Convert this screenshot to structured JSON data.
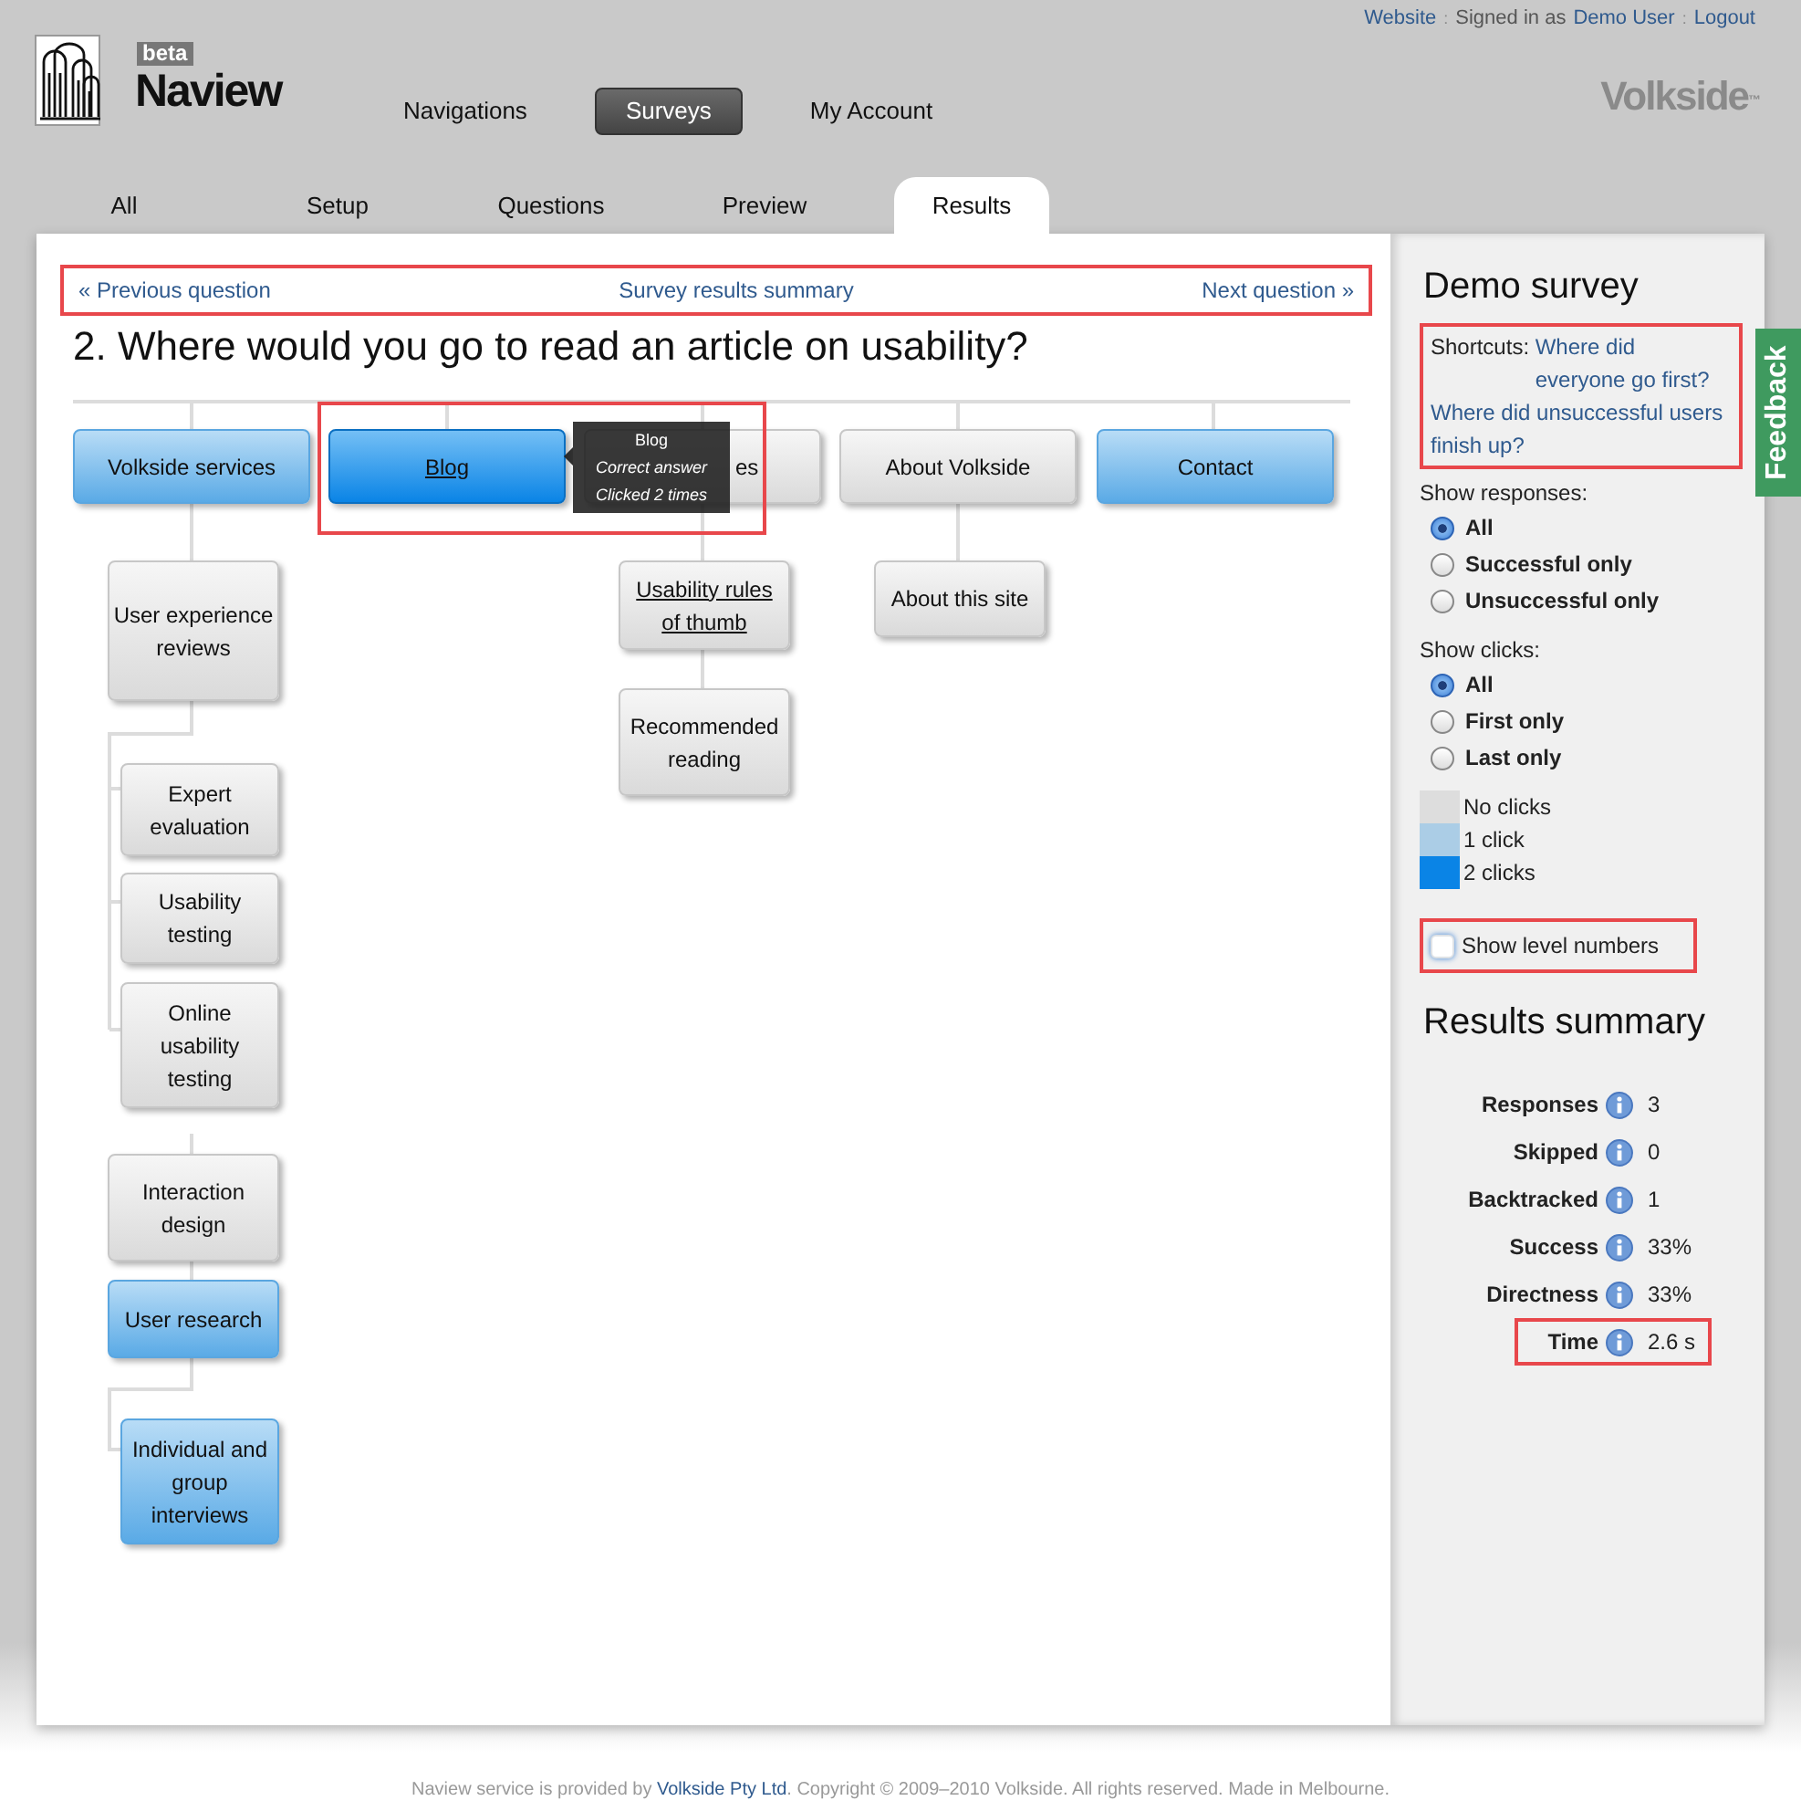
{
  "header": {
    "top_links": [
      {
        "text": "Website",
        "kind": "link"
      },
      {
        "text": ":",
        "kind": "sep"
      },
      {
        "text": "Signed in as",
        "kind": "text"
      },
      {
        "text": "Demo User",
        "kind": "link"
      },
      {
        "text": ":",
        "kind": "sep"
      },
      {
        "text": "Logout",
        "kind": "link"
      }
    ],
    "logo": {
      "badge": "beta",
      "name": "Naview"
    },
    "brand": {
      "name": "Volkside",
      "mark": "™"
    },
    "nav": [
      {
        "label": "Navigations",
        "selected": false
      },
      {
        "label": "Surveys",
        "selected": true
      },
      {
        "label": "My Account",
        "selected": false
      }
    ]
  },
  "tabs": [
    {
      "label": "All",
      "selected": false
    },
    {
      "label": "Setup",
      "selected": false
    },
    {
      "label": "Questions",
      "selected": false
    },
    {
      "label": "Preview",
      "selected": false
    },
    {
      "label": "Results",
      "selected": true
    }
  ],
  "question_nav": {
    "highlighted": true,
    "previous": "« Previous question",
    "summary": "Survey results summary",
    "next": "Next question »"
  },
  "question": "2. Where would you go to read an article on usability?",
  "tree": [
    {
      "label": "Volkside services",
      "kind": "light",
      "correct": false,
      "children": [
        {
          "label": "User experience reviews",
          "kind": "plain",
          "correct": false,
          "children": [
            {
              "label": "Expert evaluation",
              "kind": "plain",
              "correct": false
            },
            {
              "label": "Usability testing",
              "kind": "plain",
              "correct": false
            },
            {
              "label": "Online usability testing",
              "kind": "plain",
              "correct": false
            }
          ]
        },
        {
          "label": "Interaction design",
          "kind": "plain",
          "correct": false
        },
        {
          "label": "User research",
          "kind": "light",
          "correct": false,
          "children": [
            {
              "label": "Individual and group interviews",
              "kind": "light",
              "correct": false
            }
          ]
        }
      ]
    },
    {
      "label": "Blog",
      "kind": "dark",
      "correct": true
    },
    {
      "label": "es",
      "kind": "plain",
      "correct": false,
      "children": [
        {
          "label": "Usability rules of thumb",
          "kind": "plain",
          "correct": true
        },
        {
          "label": "Recommended reading",
          "kind": "plain",
          "correct": false
        }
      ]
    },
    {
      "label": "About Volkside",
      "kind": "plain",
      "correct": false,
      "children": [
        {
          "label": "About this site",
          "kind": "plain",
          "correct": false
        }
      ]
    },
    {
      "label": "Contact",
      "kind": "light",
      "correct": false
    }
  ],
  "tooltip": {
    "highlighted": true,
    "title": "Blog",
    "lines": [
      "Correct answer",
      "Clicked 2 times"
    ]
  },
  "sidebar": {
    "title": "Demo survey",
    "shortcuts": {
      "highlighted": true,
      "label": "Shortcuts:",
      "links": [
        "Where did everyone go first?",
        "Where did unsuccessful users finish up?"
      ]
    },
    "response_filter": {
      "label": "Show responses:",
      "options": [
        {
          "label": "All",
          "selected": true
        },
        {
          "label": "Successful only",
          "selected": false
        },
        {
          "label": "Unsuccessful only",
          "selected": false
        }
      ]
    },
    "click_filter": {
      "label": "Show clicks:",
      "options": [
        {
          "label": "All",
          "selected": true
        },
        {
          "label": "First only",
          "selected": false
        },
        {
          "label": "Last only",
          "selected": false
        }
      ]
    },
    "legend": [
      {
        "label": "No clicks",
        "color": "#dddddd"
      },
      {
        "label": "1 click",
        "color": "#abcde6"
      },
      {
        "label": "2 clicks",
        "color": "#0a84e6"
      }
    ],
    "level_numbers": {
      "label": "Show level numbers",
      "checked": false,
      "highlighted": true
    },
    "summary_title": "Results summary",
    "stats": [
      {
        "label": "Responses",
        "value": "3",
        "highlighted": false
      },
      {
        "label": "Skipped",
        "value": "0",
        "highlighted": false
      },
      {
        "label": "Backtracked",
        "value": "1",
        "highlighted": false
      },
      {
        "label": "Success",
        "value": "33%",
        "highlighted": false
      },
      {
        "label": "Directness",
        "value": "33%",
        "highlighted": false
      },
      {
        "label": "Time",
        "value": "2.6 s",
        "highlighted": true
      }
    ]
  },
  "feedback": "Feedback",
  "footer": {
    "before": "Naview service is provided by ",
    "link": "Volkside Pty Ltd",
    "after": ". Copyright © 2009–2010 Volkside. All rights reserved. Made in Melbourne."
  }
}
